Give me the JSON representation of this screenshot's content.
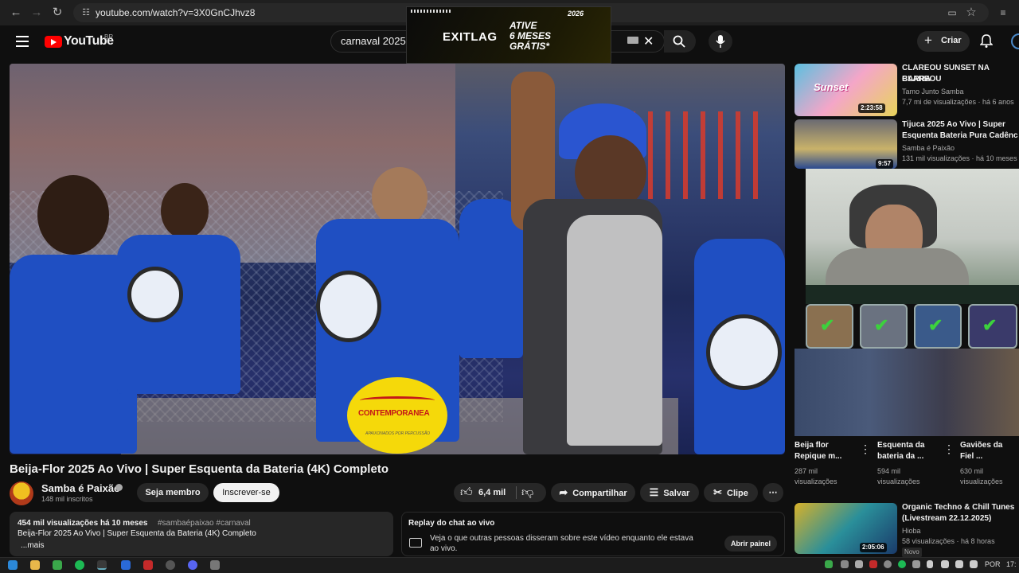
{
  "browser": {
    "url": "youtube.com/watch?v=3X0GnCJhvz8",
    "nav_icons": [
      "back-icon",
      "forward-icon",
      "reload-icon",
      "site-info-icon"
    ],
    "right_icons": [
      "cast-icon",
      "bookmark-star-icon",
      "reading-list-icon"
    ]
  },
  "header": {
    "logo_text": "YouTube",
    "country_code": "BR",
    "search_query": "carnaval 2025 p",
    "create_label": "Criar"
  },
  "ad": {
    "brand": "EXITLAG",
    "line1": "ATIVE",
    "line2": "6 MESES",
    "line3": "GRÁTIS*",
    "badge": "2026"
  },
  "video": {
    "overlay_logo_text": "CONTEMPORANEA",
    "overlay_logo_sub": "APAIXONADOS POR PERCUSSÃO"
  },
  "watch": {
    "title": "Beija-Flor 2025 Ao Vivo | Super Esquenta da Bateria (4K) Completo",
    "channel_name": "Samba é Paixão",
    "subscribers": "148 mil inscritos",
    "member_label": "Seja membro",
    "subscribe_label": "Inscrever-se",
    "likes": "6,4 mil",
    "share_label": "Compartilhar",
    "save_label": "Salvar",
    "clip_label": "Clipe"
  },
  "description": {
    "meta": "454 mil visualizações  há 10 meses",
    "tags": "#sambaépaixao #carnaval",
    "text": "Beija-Flor 2025 Ao Vivo |  Super Esquenta da Bateria (4K) Completo",
    "more": "...mais"
  },
  "chat": {
    "title": "Replay do chat ao vivo",
    "text_line1": "Veja o que outras pessoas disseram sobre este vídeo enquanto ele estava",
    "text_line2": "ao vivo.",
    "open_label": "Abrir painel"
  },
  "sidebar": {
    "related": [
      {
        "title_line1": "CLAREOU SUNSET NA BARRA",
        "title_line2": "CLAREOU",
        "channel": "Tamo Junto Samba",
        "meta": "7,7 mi de visualizações · há 6 anos",
        "duration": "2:23:58",
        "thumb_text": "Sunset"
      },
      {
        "title_line1": "Tijuca 2025 Ao Vivo |  Super",
        "title_line2": "Esquenta Bateria Pura Cadênc",
        "channel": "Samba é Paixão",
        "meta": "131 mil visualizações · há 10 meses",
        "duration": "9:57"
      }
    ],
    "shorts": [
      {
        "title_line1": "Beija flor",
        "title_line2": "Repique m...",
        "views_line1": "287 mil",
        "views_line2": "visualizações"
      },
      {
        "title_line1": "Esquenta da",
        "title_line2": "bateria da ...",
        "views_line1": "594 mil",
        "views_line2": "visualizações"
      },
      {
        "title_line1": "Gaviões da",
        "title_line2": "Fiel ...",
        "views_line1": "630 mil",
        "views_line2": "visualizações"
      }
    ],
    "bottom": {
      "title_line1": "Organic Techno & Chill Tunes",
      "title_line2": "(Livestream 22.12.2025)",
      "channel": "Hioba",
      "meta": "58 visualizações · há 8 horas",
      "badge": "Novo",
      "duration": "2:05:06"
    }
  },
  "taskbar": {
    "language": "POR",
    "time": "17:"
  }
}
